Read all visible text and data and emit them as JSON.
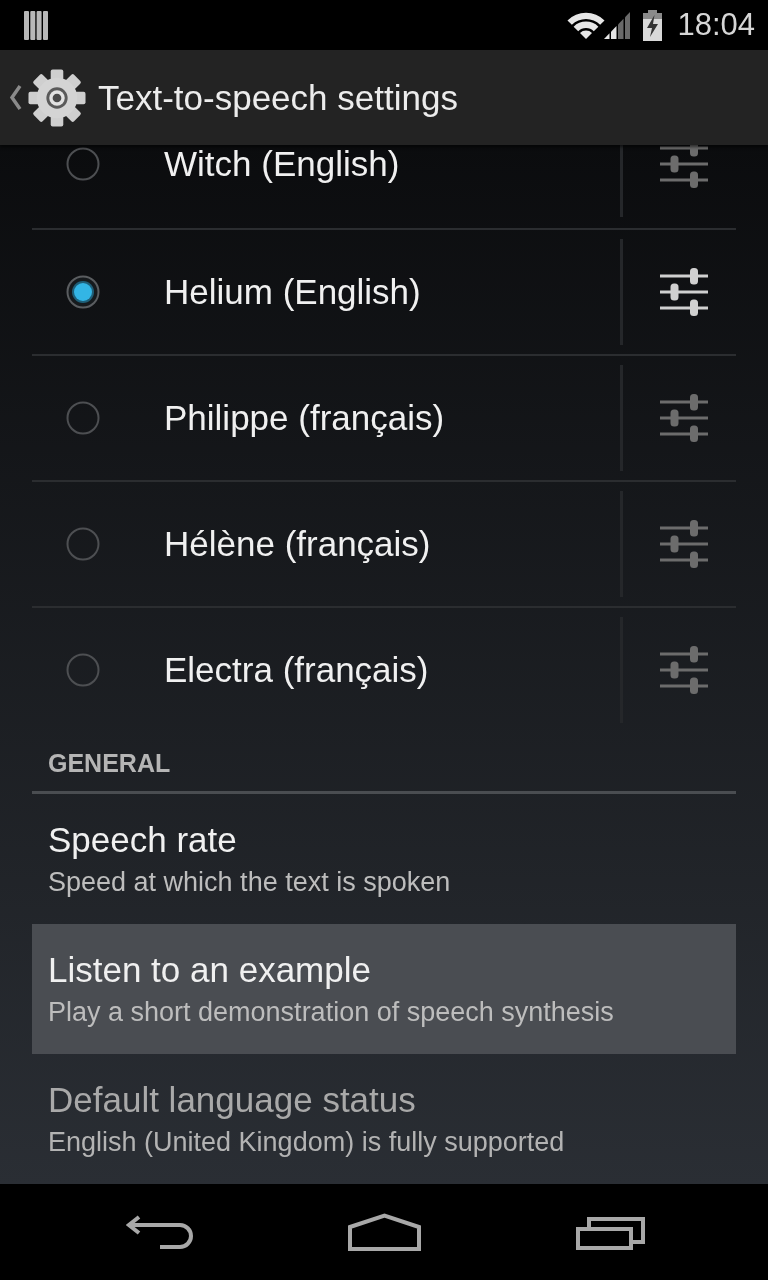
{
  "status_bar": {
    "time": "18:04"
  },
  "action_bar": {
    "title": "Text-to-speech settings"
  },
  "voices": [
    {
      "name": "Witch (English)",
      "selected": false
    },
    {
      "name": "Helium (English)",
      "selected": true
    },
    {
      "name": "Philippe (français)",
      "selected": false
    },
    {
      "name": "Hélène (français)",
      "selected": false
    },
    {
      "name": "Electra (français)",
      "selected": false
    }
  ],
  "general": {
    "heading": "GENERAL",
    "items": [
      {
        "title": "Speech rate",
        "summary": "Speed at which the text is spoken",
        "pressed": false,
        "disabled": false
      },
      {
        "title": "Listen to an example",
        "summary": "Play a short demonstration of speech synthesis",
        "pressed": true,
        "disabled": false
      },
      {
        "title": "Default language status",
        "summary": "English (United Kingdom) is fully supported",
        "pressed": false,
        "disabled": true
      }
    ]
  }
}
